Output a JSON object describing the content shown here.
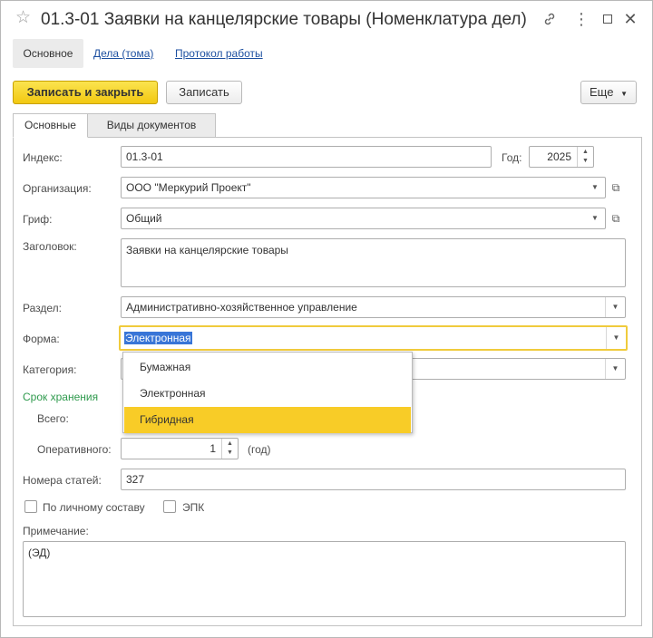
{
  "window": {
    "title": "01.3-01 Заявки на канцелярские товары (Номенклатура дел)"
  },
  "nav": {
    "main": "Основное",
    "cases": "Дела (тома)",
    "protocol": "Протокол работы"
  },
  "toolbar": {
    "save_close_label": "Записать и закрыть",
    "save_label": "Записать",
    "more_label": "Еще"
  },
  "tabs": [
    {
      "label": "Основные"
    },
    {
      "label": "Виды документов"
    }
  ],
  "form": {
    "index": {
      "label": "Индекс:",
      "value": "01.3-01"
    },
    "year": {
      "label": "Год:",
      "value": "2025"
    },
    "organization": {
      "label": "Организация:",
      "value": "ООО \"Меркурий Проект\""
    },
    "grif": {
      "label": "Гриф:",
      "value": "Общий"
    },
    "heading": {
      "label": "Заголовок:",
      "value": "Заявки на канцелярские товары"
    },
    "section": {
      "label": "Раздел:",
      "value": "Административно-хозяйственное управление"
    },
    "form_type": {
      "label": "Форма:",
      "value": "Электронная"
    },
    "category": {
      "label": "Категория:",
      "value": ""
    },
    "storage": {
      "title": "Срок хранения",
      "total_label": "Всего:",
      "operative_label": "Оперативного:",
      "operative_value": "1",
      "unit": "(год)"
    },
    "article_numbers": {
      "label": "Номера статей:",
      "value": "327"
    },
    "personal_staff": {
      "label": "По личному составу",
      "checked": false
    },
    "epk": {
      "label": "ЭПК",
      "checked": false
    },
    "note": {
      "label": "Примечание:",
      "value": "(ЭД)"
    }
  },
  "dropdown": {
    "options": [
      {
        "label": "Бумажная"
      },
      {
        "label": "Электронная"
      },
      {
        "label": "Гибридная"
      }
    ],
    "highlighted": "Гибридная"
  },
  "colors": {
    "accent_yellow": "#f2c811",
    "focus_border": "#f0cb3c",
    "link_blue": "#1c4fa0",
    "section_green": "#2f9a4d",
    "selection_blue": "#3875d7"
  }
}
